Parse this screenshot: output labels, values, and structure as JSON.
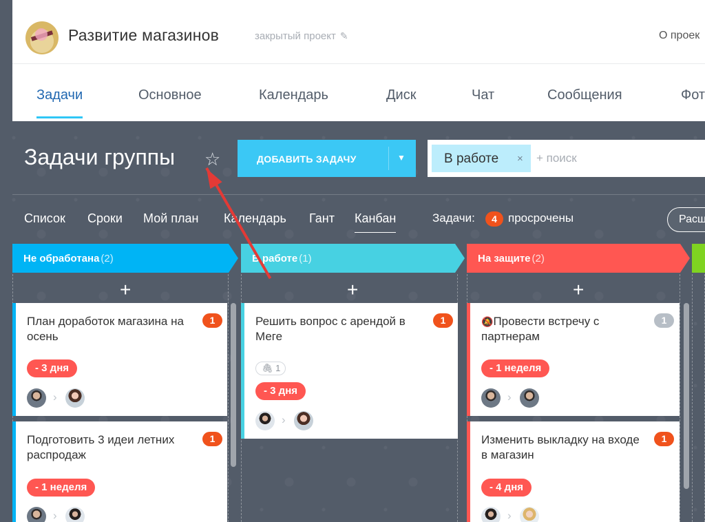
{
  "project": {
    "title": "Развитие магазинов",
    "type": "закрытый проект",
    "about": "О проек"
  },
  "tabs": [
    "Задачи",
    "Основное",
    "Календарь",
    "Диск",
    "Чат",
    "Сообщения",
    "Фот"
  ],
  "toolbar": {
    "page_title": "Задачи группы",
    "add_task": "ДОБАВИТЬ ЗАДАЧУ",
    "filter_chip": "В работе",
    "search_placeholder": "+ поиск"
  },
  "views": [
    "Список",
    "Сроки",
    "Мой план",
    "Календарь",
    "Гант",
    "Канбан"
  ],
  "counter": {
    "label": "Задачи:",
    "value": "4",
    "after": "просрочены",
    "expand": "Расш"
  },
  "columns": [
    {
      "name": "Не обработана",
      "count": "(2)",
      "color": "#00b4f5",
      "cards": [
        {
          "title": "План доработок магазина на осень",
          "badge": "1",
          "deadline": "- 3 дня"
        },
        {
          "title": "Подготовить 3 идеи летних распродаж",
          "badge": "1",
          "deadline": "- 1 неделя"
        }
      ]
    },
    {
      "name": "В работе",
      "count": "(1)",
      "color": "#47d1e2",
      "cards": [
        {
          "title": "Решить вопрос с арендой в Меге",
          "badge": "1",
          "attachment": "1",
          "deadline": "- 3 дня"
        }
      ]
    },
    {
      "name": "На защите",
      "count": "(2)",
      "color": "#ff5752",
      "cards": [
        {
          "title": "Провести встречу с партнерам",
          "badge": "1",
          "deadline": "- 1 неделя",
          "muted": true
        },
        {
          "title": "Изменить выкладку на входе в магазин",
          "badge": "1",
          "deadline": "- 4 дня"
        }
      ]
    }
  ],
  "icons": {
    "star": "star-icon",
    "pencil": "pencil-icon",
    "close": "close-icon",
    "dropdown": "chevron-down-icon",
    "paperclip": "paperclip-icon",
    "muted": "bell-off-icon"
  }
}
